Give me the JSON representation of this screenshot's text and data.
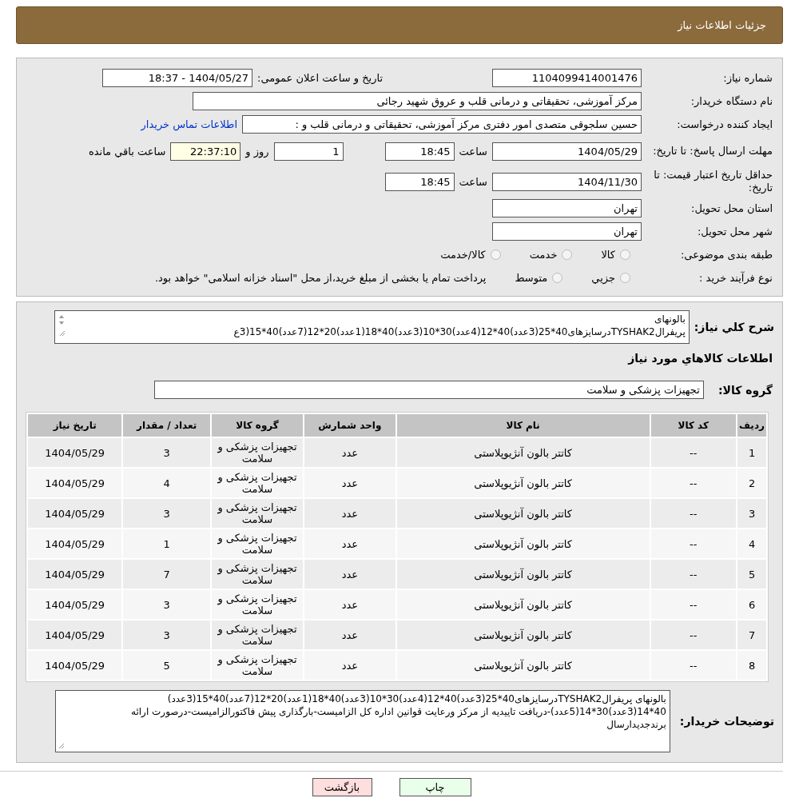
{
  "header": {
    "title": "جزئیات اطلاعات نیاز"
  },
  "need_number": {
    "label": "شماره نیاز:",
    "value": "1104099414001476"
  },
  "announce": {
    "label": "تاریخ و ساعت اعلان عمومی:",
    "value": "1404/05/27 - 18:37"
  },
  "buyer_org": {
    "label": "نام دستگاه خریدار:",
    "value": "مرکز آموزشی، تحقیقاتی و درمانی قلب و عروق شهید رجائی"
  },
  "requester": {
    "label": "ایجاد کننده درخواست:",
    "value": "حسین سلجوقی متصدی امور دفتری مرکز آموزشی، تحقیقاتی و درمانی قلب و :",
    "link": "اطلاعات تماس خریدار"
  },
  "reply_deadline": {
    "label": "مهلت ارسال پاسخ: تا تاریخ:",
    "date": "1404/05/29",
    "time_label": "ساعت",
    "time": "18:45",
    "days": "1",
    "days_label": "روز و",
    "remaining": "22:37:10",
    "remaining_label": "ساعت باقي مانده"
  },
  "price_validity": {
    "label": "حداقل تاریخ اعتبار قیمت: تا تاریخ:",
    "date": "1404/11/30",
    "time_label": "ساعت",
    "time": "18:45"
  },
  "province": {
    "label": "استان محل تحویل:",
    "value": "تهران"
  },
  "city": {
    "label": "شهر محل تحویل:",
    "value": "تهران"
  },
  "category": {
    "label": "طبقه بندی موضوعی:",
    "options": [
      {
        "label": "كالا",
        "selected": false
      },
      {
        "label": "خدمت",
        "selected": false
      },
      {
        "label": "كالا/خدمت",
        "selected": false
      }
    ]
  },
  "process": {
    "label": "نوع فرآیند خرید :",
    "options": [
      {
        "label": "جزيي",
        "selected": false
      },
      {
        "label": "متوسط",
        "selected": false
      }
    ],
    "note": "پرداخت تمام یا بخشی از مبلغ خرید،از محل \"اسناد خزانه اسلامی\" خواهد بود."
  },
  "summary": {
    "label": "شرح کلي نیاز:",
    "lines": [
      "بالونهای",
      "پریفرالTYSHAK2درسایزهای40*25(3عدد)40*12(4عدد)30*10(3عدد)40*18(1عدد)20*12(7عدد)40*15(3ع"
    ]
  },
  "goods_title": "اطلاعات کالاهاي مورد نیاز",
  "goods_group": {
    "label": "گروه کالا:",
    "value": "تجهیزات پزشکی و سلامت"
  },
  "table": {
    "columns": [
      "ردیف",
      "کد کالا",
      "نام کالا",
      "واحد شمارش",
      "گروه کالا",
      "تعداد / مقدار",
      "تاریخ نیاز"
    ],
    "rows": [
      [
        "1",
        "--",
        "کاتتر بالون آنژیوپلاستی",
        "عدد",
        "تجهیزات پزشکی و سلامت",
        "3",
        "1404/05/29"
      ],
      [
        "2",
        "--",
        "کاتتر بالون آنژیوپلاستی",
        "عدد",
        "تجهیزات پزشکی و سلامت",
        "4",
        "1404/05/29"
      ],
      [
        "3",
        "--",
        "کاتتر بالون آنژیوپلاستی",
        "عدد",
        "تجهیزات پزشکی و سلامت",
        "3",
        "1404/05/29"
      ],
      [
        "4",
        "--",
        "کاتتر بالون آنژیوپلاستی",
        "عدد",
        "تجهیزات پزشکی و سلامت",
        "1",
        "1404/05/29"
      ],
      [
        "5",
        "--",
        "کاتتر بالون آنژیوپلاستی",
        "عدد",
        "تجهیزات پزشکی و سلامت",
        "7",
        "1404/05/29"
      ],
      [
        "6",
        "--",
        "کاتتر بالون آنژیوپلاستی",
        "عدد",
        "تجهیزات پزشکی و سلامت",
        "3",
        "1404/05/29"
      ],
      [
        "7",
        "--",
        "کاتتر بالون آنژیوپلاستی",
        "عدد",
        "تجهیزات پزشکی و سلامت",
        "3",
        "1404/05/29"
      ],
      [
        "8",
        "--",
        "کاتتر بالون آنژیوپلاستی",
        "عدد",
        "تجهیزات پزشکی و سلامت",
        "5",
        "1404/05/29"
      ]
    ]
  },
  "buyer_notes": {
    "label": "توضیحات خریدار:",
    "value": "بالونهای پریفرالTYSHAK2درسایزهای40*25(3عدد)40*12(4عدد)30*10(3عدد)40*18(1عدد)20*12(7عدد)40*15(3عدد) 40*14(3عدد)30*14(5عدد)-دریافت تاییدیه از مرکز ورعایت قوانین اداره کل الزامیست-بارگذاری پیش فاکتورالزامیست-درصورت ارائه برندجدیدارسال"
  },
  "buttons": [
    {
      "label": "چاپ",
      "kind": "print"
    },
    {
      "label": "بازگشت",
      "kind": "back"
    }
  ]
}
